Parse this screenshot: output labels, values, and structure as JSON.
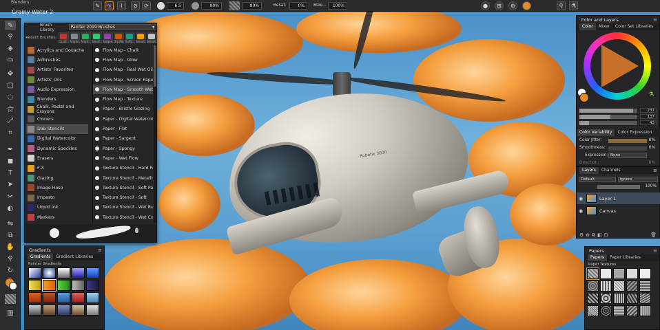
{
  "topbar": {
    "brush_category": "Blenders",
    "brush_variant": "Grainy Water 2",
    "size_value": "6.5",
    "opacity_value": "80%",
    "grain_value": "80%",
    "resat_label": "Resat:",
    "resat_value": "0%",
    "bleed_label": "Blee...",
    "bleed_value": "100%"
  },
  "brush_library": {
    "title_label": "Brush Library",
    "library_name": "Painter 2019 Brushes",
    "recent_label": "Recent Brushes:",
    "recent": [
      {
        "name": "Coast..",
        "color": "#c0392b"
      },
      {
        "name": "Acrylic..",
        "color": "#7f8c8d"
      },
      {
        "name": "Acryli..",
        "color": "#27ae60"
      },
      {
        "name": "Smud..",
        "color": "#2ecc71"
      },
      {
        "name": "Sargen..",
        "color": "#8e44ad"
      },
      {
        "name": "Dry Pal..",
        "color": "#d35400"
      },
      {
        "name": "Fluffy..",
        "color": "#16a085"
      },
      {
        "name": "Smoot..",
        "color": "#f39c12"
      },
      {
        "name": "Smoot..",
        "color": "#bdc3c7"
      }
    ],
    "categories": [
      {
        "label": "Acrylics and Gouache",
        "color": "#b36a3a"
      },
      {
        "label": "Airbrushes",
        "color": "#5a7fa0"
      },
      {
        "label": "Artists' Favorites",
        "color": "#a04a4a"
      },
      {
        "label": "Artists' Oils",
        "color": "#6a8a3a"
      },
      {
        "label": "Audio Expression",
        "color": "#7a5aa0"
      },
      {
        "label": "Blenders",
        "color": "#3a8aa0"
      },
      {
        "label": "Chalk, Pastel and Crayons",
        "color": "#c09a3a"
      },
      {
        "label": "Cloners",
        "color": "#5a5a5a"
      },
      {
        "label": "Dab Stencils",
        "color": "#8a8a8a"
      },
      {
        "label": "Digital Watercolor",
        "color": "#3a6ab0"
      },
      {
        "label": "Dynamic Speckles",
        "color": "#b05a8a"
      },
      {
        "label": "Erasers",
        "color": "#d0d0d0"
      },
      {
        "label": "F-X",
        "color": "#e0a020"
      },
      {
        "label": "Glazing",
        "color": "#4a9a7a"
      },
      {
        "label": "Image Hose",
        "color": "#9a4a2a"
      },
      {
        "label": "Impasto",
        "color": "#7a6a4a"
      },
      {
        "label": "Liquid Ink",
        "color": "#2a2a6a"
      },
      {
        "label": "Markers",
        "color": "#c04040"
      }
    ],
    "selected_category_index": 8,
    "variants": [
      "Flow Map - Chalk",
      "Flow Map - Glow",
      "Flow Map - Real Wet Oil",
      "Flow Map - Screen Paper",
      "Flow Map - Smooth Wet Oil",
      "Flow Map - Texture",
      "Paper - Bristle Glazing",
      "Paper - Digital Watercolor Pap",
      "Paper - Flat",
      "Paper - Sargent",
      "Paper - Spongy",
      "Paper - Wet Flow",
      "Texture Stencil - Hard Pastel",
      "Texture Stencil - Metallic",
      "Texture Stencil - Soft Pastel",
      "Texture Stencil - Soft",
      "Texture Stencil - Wet Buildup",
      "Texture Stencil - Wet Cover"
    ],
    "selected_variant_index": 4
  },
  "gradients": {
    "title": "Gradients",
    "tabs": [
      "Gradients",
      "Gradient Libraries"
    ],
    "section_label": "Painter Gradients",
    "swatches": [
      "linear-gradient(135deg,#fff,#2a3a9a)",
      "radial-gradient(circle,#fff,#2a4aa0)",
      "linear-gradient(180deg,#fff,#6a6a6a)",
      "linear-gradient(180deg,#a0a0ff,#2020a0)",
      "linear-gradient(180deg,#60a0ff,#1040c0)",
      "linear-gradient(90deg,#f0e060,#c0a020)",
      "linear-gradient(90deg,#f0a020,#e06010)",
      "linear-gradient(90deg,#60d040,#2a8a20)",
      "linear-gradient(90deg,#c0c0c0,#606060)",
      "linear-gradient(90deg,#3a3a8a,#1a1a3a)",
      "linear-gradient(180deg,#e06020,#a03010)",
      "linear-gradient(180deg,#c05020,#802010)",
      "linear-gradient(180deg,#5a9ae0,#2a5aa0)",
      "linear-gradient(180deg,#e06060,#a02020)",
      "linear-gradient(180deg,#a0d0f0,#4a80b0)",
      "linear-gradient(180deg,#d0d0d0,#505050)",
      "linear-gradient(180deg,#c0a080,#604020)",
      "linear-gradient(180deg,#8090c0,#303860)",
      "linear-gradient(180deg,#d0c0a0,#705030)",
      "linear-gradient(180deg,#e0e0e0,#808080)"
    ]
  },
  "color_panel": {
    "title": "Color and Layers",
    "tabs": [
      "Color",
      "Mixer",
      "Color Set Libraries"
    ],
    "values": [
      "237",
      "137",
      "43"
    ],
    "tabs2": [
      "Color Variability",
      "Color Expression"
    ],
    "color_jitter_label": "Color Jitter:",
    "color_jitter_value": "0%",
    "smoothness_label": "Smoothness:",
    "smoothness_value": "0%",
    "expression_label": "Expression:",
    "expression_value": "None",
    "direction_label": "Direction:",
    "direction_value": "0%",
    "main_color": "#e08a2a"
  },
  "layers": {
    "tabs": [
      "Layers",
      "Channels"
    ],
    "blend_mode": "Default",
    "composite": "Ignore",
    "opacity": "100%",
    "items": [
      "Layer 1",
      "Canvas"
    ]
  },
  "papers": {
    "title": "Papers",
    "tabs": [
      "Papers",
      "Paper Libraries"
    ],
    "section_label": "Paper Textures"
  },
  "canvas": {
    "brand_text": "Robotix 3000"
  }
}
